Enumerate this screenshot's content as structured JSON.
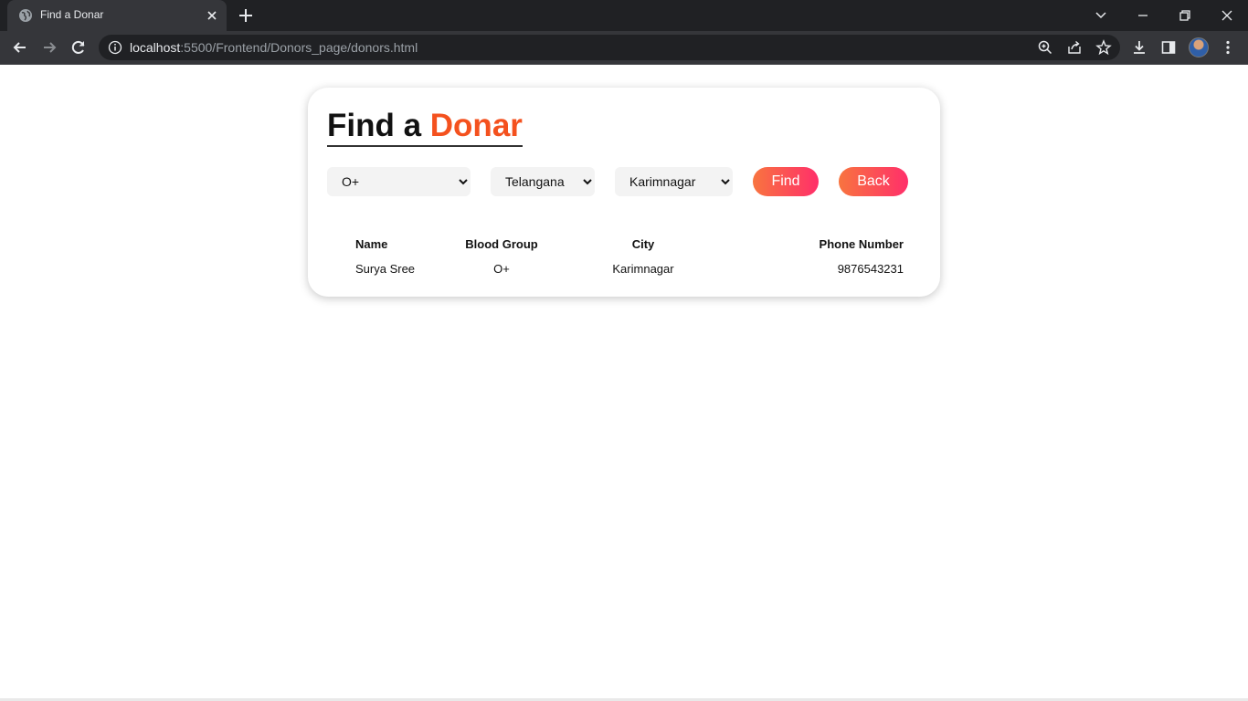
{
  "browser": {
    "tab_title": "Find a Donar",
    "url_host": "localhost",
    "url_path": ":5500/Frontend/Donors_page/donors.html"
  },
  "page": {
    "heading_plain": "Find a ",
    "heading_accent": "Donar",
    "accent_color": "#f4511e",
    "filters": {
      "blood_group": "O+",
      "state": "Telangana",
      "city": "Karimnagar"
    },
    "find_label": "Find",
    "back_label": "Back",
    "button_gradient": [
      "#f8743f",
      "#ff2f6a"
    ],
    "table": {
      "headers": [
        "Name",
        "Blood Group",
        "City",
        "Phone Number"
      ],
      "rows": [
        [
          "Surya Sree",
          "O+",
          "Karimnagar",
          "9876543231"
        ]
      ]
    }
  }
}
